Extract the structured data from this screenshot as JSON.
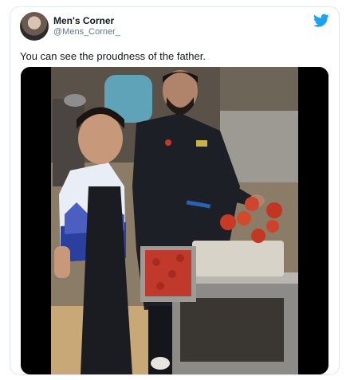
{
  "tweet": {
    "author_name": "Men's Corner",
    "author_handle": "@Mens_Corner_",
    "text": "You can see the proudness of the father.",
    "avatar_icon": "profile-avatar",
    "brand_icon": "twitter-bird-icon",
    "brand_color": "#1da1f2"
  },
  "media": {
    "type": "video-still",
    "description_icon": "kitchen-scene"
  }
}
